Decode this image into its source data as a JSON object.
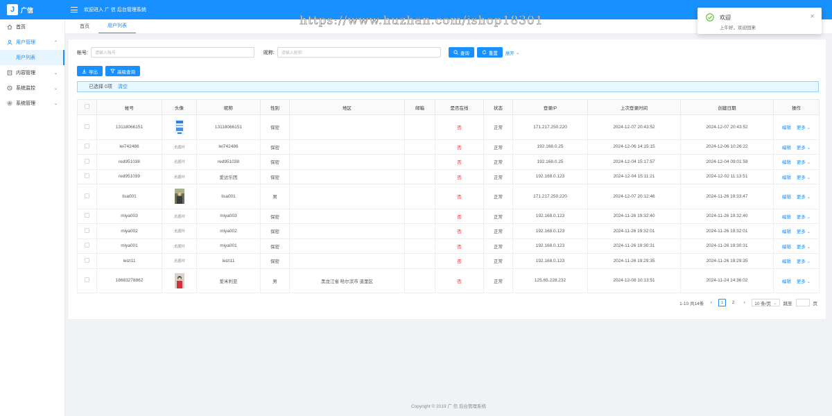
{
  "header": {
    "logo_letter": "J",
    "logo_text": "广信",
    "welcome": "欢迎进入 广 信 后台管理系统",
    "watermark": "https://www.huzhan.com/ishop18301"
  },
  "notification": {
    "title": "欢迎",
    "description": "上午好，欢迎回来"
  },
  "sidebar": {
    "items": [
      {
        "label": "首页",
        "icon": "home-icon"
      },
      {
        "label": "用户管理",
        "icon": "user-icon",
        "expanded": true,
        "children": [
          {
            "label": "用户列表"
          }
        ]
      },
      {
        "label": "内容管理",
        "icon": "file-icon"
      },
      {
        "label": "系统监控",
        "icon": "monitor-icon"
      },
      {
        "label": "系统管理",
        "icon": "gear-icon"
      }
    ]
  },
  "tabs": [
    {
      "label": "首页"
    },
    {
      "label": "用户列表",
      "active": true
    }
  ],
  "search": {
    "account_label": "帐号:",
    "account_placeholder": "请输入帐号",
    "nickname_label": "昵称:",
    "nickname_placeholder": "请输入昵称",
    "query_label": "查询",
    "reset_label": "重置",
    "expand_label": "展开"
  },
  "actions": {
    "export_label": "导出",
    "advanced_label": "高级查询"
  },
  "selection": {
    "text": "已选择 0项",
    "clear_label": "清空"
  },
  "table": {
    "columns": [
      "帐号",
      "头像",
      "昵称",
      "性别",
      "地区",
      "邮箱",
      "是否在线",
      "状态",
      "登录IP",
      "上次登录时间",
      "创建日期",
      "操作"
    ],
    "edit_label": "编辑",
    "more_label": "更多",
    "rows": [
      {
        "account": "13118066151",
        "avatar": "image-blue",
        "nickname": "13118066151",
        "gender": "保密",
        "region": "",
        "email": "",
        "online": "否",
        "status": "正常",
        "ip": "171.217.250.220",
        "last_login": "2024-12-07 20:43:52",
        "created": "2024-12-07 20:43:52"
      },
      {
        "account": "lei742486",
        "avatar": "无图片",
        "nickname": "lei742486",
        "gender": "保密",
        "region": "",
        "email": "",
        "online": "否",
        "status": "正常",
        "ip": "192.168.0.25",
        "last_login": "2024-12-06 14:15:15",
        "created": "2024-12-06 10:26:22"
      },
      {
        "account": "red951038",
        "avatar": "无图片",
        "nickname": "red951038",
        "gender": "保密",
        "region": "",
        "email": "",
        "online": "否",
        "status": "正常",
        "ip": "192.168.0.25",
        "last_login": "2024-12-04 15:17:57",
        "created": "2024-12-04 09:01:59"
      },
      {
        "account": "red951039",
        "avatar": "无图片",
        "nickname": "爱达乐团",
        "gender": "保密",
        "region": "",
        "email": "",
        "online": "否",
        "status": "正常",
        "ip": "192.168.0.123",
        "last_login": "2024-12-04 15:11:21",
        "created": "2024-12-02 11:13:51"
      },
      {
        "account": "lisa001",
        "avatar": "image-photo",
        "nickname": "lisa001",
        "gender": "男",
        "region": "",
        "email": "",
        "online": "否",
        "status": "正常",
        "ip": "171.217.250.220",
        "last_login": "2024-12-07 20:12:46",
        "created": "2024-11-26 19:33:47"
      },
      {
        "account": "miya003",
        "avatar": "无图片",
        "nickname": "miya003",
        "gender": "保密",
        "region": "",
        "email": "",
        "online": "否",
        "status": "正常",
        "ip": "192.168.0.123",
        "last_login": "2024-11-26 19:32:40",
        "created": "2024-11-26 19:32:40"
      },
      {
        "account": "miya002",
        "avatar": "无图片",
        "nickname": "miya002",
        "gender": "保密",
        "region": "",
        "email": "",
        "online": "否",
        "status": "正常",
        "ip": "192.168.0.123",
        "last_login": "2024-11-26 19:32:01",
        "created": "2024-11-26 19:32:01"
      },
      {
        "account": "miya001",
        "avatar": "无图片",
        "nickname": "miya001",
        "gender": "保密",
        "region": "",
        "email": "",
        "online": "否",
        "status": "正常",
        "ip": "192.168.0.123",
        "last_login": "2024-11-26 19:30:31",
        "created": "2024-11-26 19:30:31"
      },
      {
        "account": "leizi11",
        "avatar": "无图片",
        "nickname": "leizi11",
        "gender": "保密",
        "region": "",
        "email": "",
        "online": "否",
        "status": "正常",
        "ip": "192.168.0.123",
        "last_login": "2024-11-26 19:29:35",
        "created": "2024-11-26 19:29:35"
      },
      {
        "account": "18683278862",
        "avatar": "image-red",
        "nickname": "爱米利亚",
        "gender": "男",
        "region": "黑龙江省 哈尔滨市 道里区",
        "email": "",
        "online": "否",
        "status": "正常",
        "ip": "125.65.228.232",
        "last_login": "2024-12-08 10:13:51",
        "created": "2024-11-24 14:36:02"
      }
    ]
  },
  "pagination": {
    "total_text": "1-10 共14条",
    "pages": [
      "1",
      "2"
    ],
    "current_page": "1",
    "page_size": "10 条/页",
    "jump_label": "跳至",
    "page_unit": "页"
  },
  "footer": {
    "copyright": "Copyright © 2019 广 信 后台管理系统"
  },
  "colors": {
    "primary": "#1890ff",
    "danger": "#f5222d",
    "success": "#52c41a"
  }
}
